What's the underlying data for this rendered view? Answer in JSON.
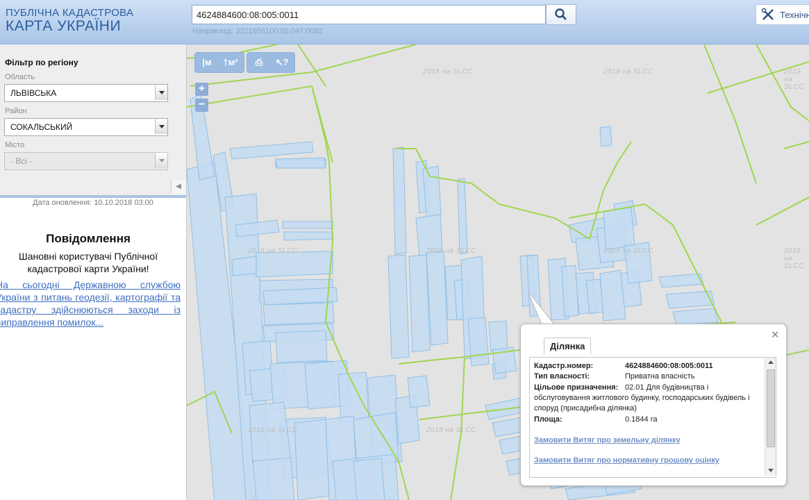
{
  "header": {
    "logo_line1": "ПУБЛІЧНА КАДАСТРОВА",
    "logo_line2": "КАРТА УКРАЇНИ",
    "search_value": "4624884600:08:005:0011",
    "search_hint": "Наприклад: 3221655100:01:047:0052",
    "tech_button_label": "Технічн"
  },
  "sidebar": {
    "filter_title": "Фільтр по регіону",
    "oblast_label": "Область",
    "oblast_value": "ЛЬВІВСЬКА",
    "raion_label": "Район",
    "raion_value": "СОКАЛЬСЬКИЙ",
    "misto_label": "Місто",
    "misto_value": "- Всі -",
    "collapse_symbol": "◀",
    "update_date": "Дата оновлення: 10.10.2018 03:00",
    "notice_title": "Повідомлення",
    "notice_line1": "Шановні користувачі Публічної",
    "notice_line2": "кадастрової карти України!",
    "notice_link": "На сьогодні Державною службою України з питань геодезії, картографії та кадастру здійснюються заходи із виправлення помилок..."
  },
  "map": {
    "tools": [
      "|м",
      "†м²",
      "⎙",
      "↖?"
    ],
    "zoom_in": "+",
    "zoom_out": "−",
    "watermark": "2018 на SLCC",
    "colors": {
      "parcel_fill": "#c4dcf2",
      "parcel_stroke": "#8fbfe6",
      "boundary": "#9fd64f",
      "background": "#e3e3e3"
    }
  },
  "popup": {
    "close_symbol": "✕",
    "tab_label": "Ділянка",
    "cadastral_label": "Кадастр.номер:",
    "cadastral_value": "4624884600:08:005:0011",
    "ownership_label": "Тип власності:",
    "ownership_value": "Приватна власність",
    "purpose_label": "Цільове призначення:",
    "purpose_value": "02.01 Для будівництва і обслуговування житлового будинку, господарських будівель і споруд (присадибна ділянка)",
    "area_label": "Площа:",
    "area_value": "0.1844 га",
    "link1": "Замовити Витяг про земельну ділянку",
    "link2": "Замовити Витяг про нормативну грошову оцінку"
  }
}
